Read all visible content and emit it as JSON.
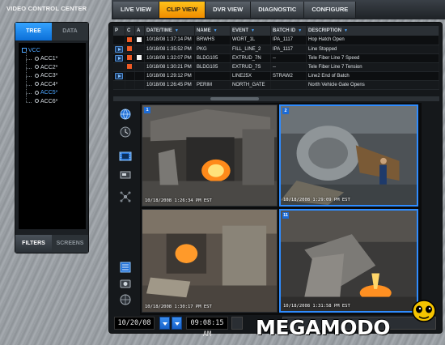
{
  "app": {
    "title": "VIDEO CONTROL CENTER"
  },
  "tabs": [
    {
      "label": "LIVE VIEW",
      "active": false
    },
    {
      "label": "CLIP VIEW",
      "active": true
    },
    {
      "label": "DVR VIEW",
      "active": false
    },
    {
      "label": "DIAGNOSTIC",
      "active": false
    },
    {
      "label": "CONFIGURE",
      "active": false
    }
  ],
  "sidebar": {
    "tabs": {
      "tree": "TREE",
      "data": "DATA"
    },
    "tree_root": "VCC",
    "tree_items": [
      "ACC1*",
      "ACC2*",
      "ACC3*",
      "ACC4*",
      "ACC5*",
      "ACC6*"
    ],
    "selected_index": 4,
    "bottom": {
      "filters": "FILTERS",
      "screens": "SCREENS"
    }
  },
  "table": {
    "headers": {
      "p": "P",
      "c": "C",
      "a": "A",
      "datetime": "DATE/TIME",
      "name": "NAME",
      "event": "EVENT",
      "batch": "BATCH ID",
      "description": "DESCRIPTION"
    },
    "rows": [
      {
        "play": false,
        "c": "orange",
        "a": "white",
        "datetime": "10/18/08  1:37:14 PM",
        "name": "BRWHS",
        "event": "WORT_1L",
        "batch": "IPA_1117",
        "description": "Hop Hatch Open"
      },
      {
        "play": true,
        "c": "orange",
        "a": "",
        "datetime": "10/18/08  1:35:52 PM",
        "name": "PKG",
        "event": "FILL_LINE_2",
        "batch": "IPA_1117",
        "description": "Line Stopped"
      },
      {
        "play": true,
        "c": "orange",
        "a": "white",
        "datetime": "10/18/08  1:32:07 PM",
        "name": "BLDG105",
        "event": "EXTRUD_7N",
        "batch": "--",
        "description": "Tele Fiber Line 7 Speed"
      },
      {
        "play": false,
        "c": "orange",
        "a": "",
        "datetime": "10/18/08  1:30:21 PM",
        "name": "BLDG105",
        "event": "EXTRUD_7S",
        "batch": "--",
        "description": "Tele Fiber Line 7 Tension"
      },
      {
        "play": true,
        "c": "",
        "a": "",
        "datetime": "10/18/08  1:29:12 PM",
        "name": "",
        "event": "LINE25X",
        "batch": "STRAW2",
        "description": "Line2 End of Batch"
      },
      {
        "play": false,
        "c": "",
        "a": "",
        "datetime": "10/18/08  1:26:45 PM",
        "name": "PERIM",
        "event": "NORTH_GATE",
        "batch": "",
        "description": "North Vehicle Gate Opens"
      }
    ]
  },
  "feeds": [
    {
      "number": "1",
      "timestamp": "10/18/2008   1:26:34 PM EST",
      "selected": false,
      "scene": "furnace"
    },
    {
      "number": "2",
      "timestamp": "10/18/2008   1:29:09 PM EST",
      "selected": true,
      "scene": "smelter"
    },
    {
      "number": "",
      "timestamp": "10/18/2008   1:30:17 PM EST",
      "selected": false,
      "scene": "casting"
    },
    {
      "number": "11",
      "timestamp": "10/18/2008   1:31:58 PM EST",
      "selected": true,
      "scene": "pour"
    }
  ],
  "side_tools": [
    "globe-icon",
    "clock-icon",
    "filmstrip-icon",
    "camera-device-icon",
    "network-icon",
    "list-icon",
    "snapshot-icon",
    "web-icon"
  ],
  "bottom": {
    "date": "10/20/08",
    "time": "09:08:15 AM"
  },
  "logo": {
    "text": "MEGAMODO"
  },
  "colors": {
    "accent": "#f5a000",
    "selection": "#2f8cff",
    "flag": "#f05a24"
  }
}
